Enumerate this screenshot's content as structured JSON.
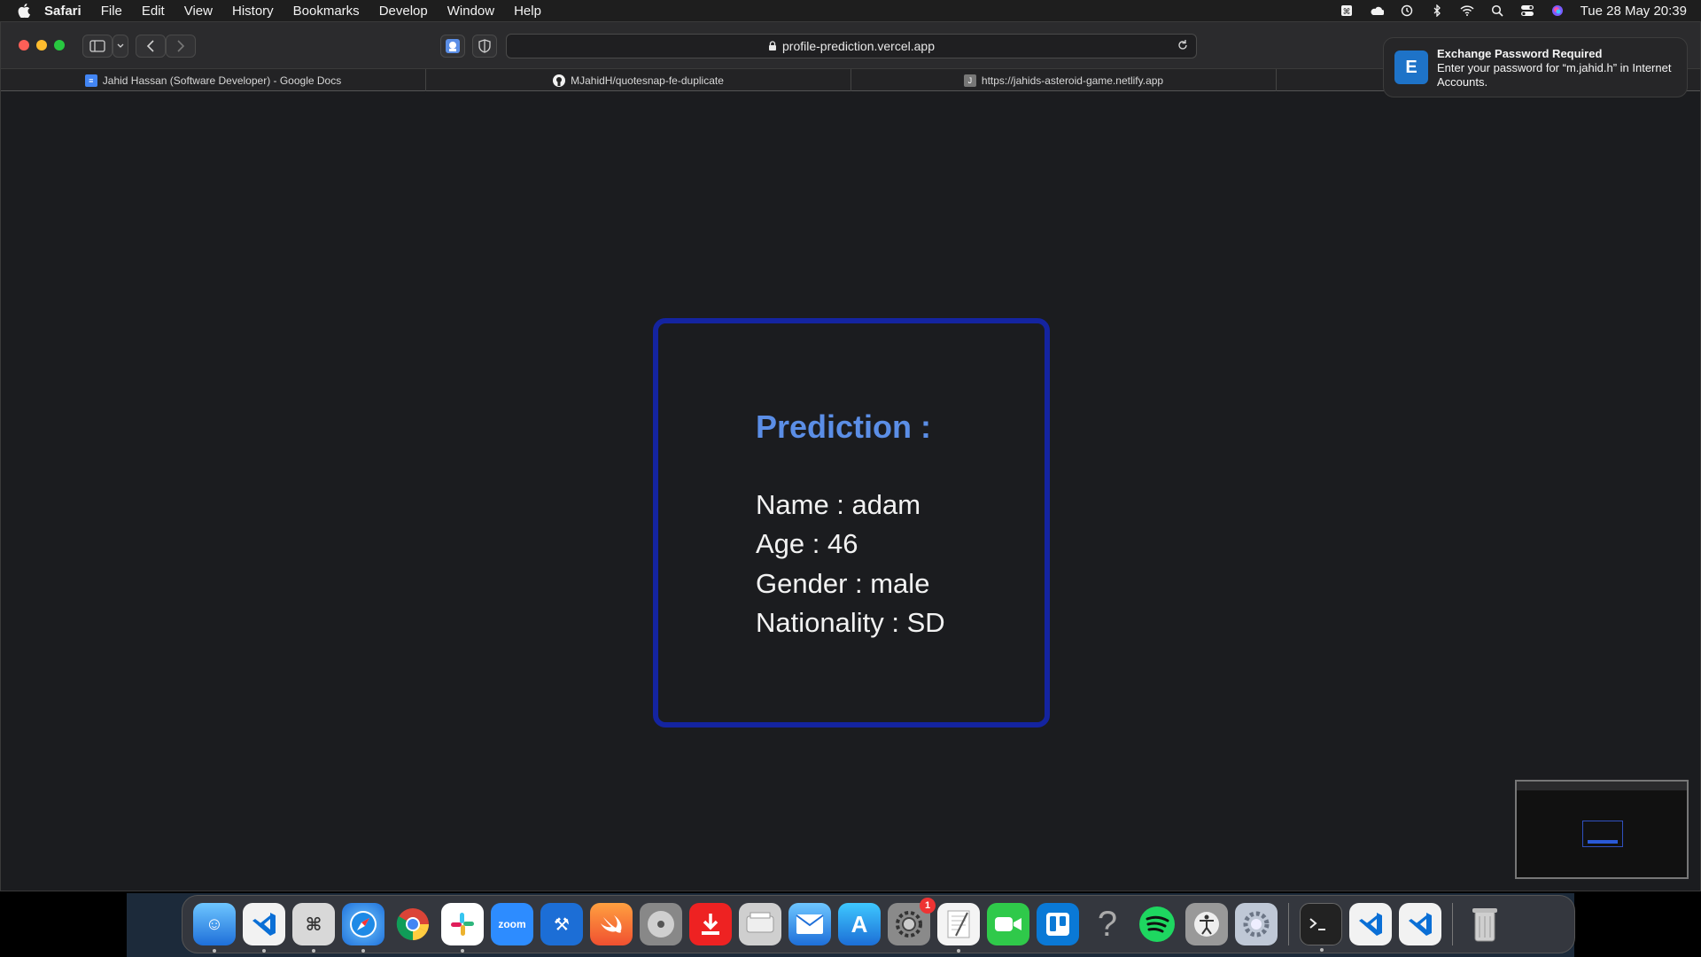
{
  "menubar": {
    "app": "Safari",
    "items": [
      "File",
      "Edit",
      "View",
      "History",
      "Bookmarks",
      "Develop",
      "Window",
      "Help"
    ],
    "datetime": "Tue 28 May  20:39"
  },
  "toolbar": {
    "url": "profile-prediction.vercel.app"
  },
  "tabs": [
    {
      "label": "Jahid Hassan (Software Developer) - Google Docs"
    },
    {
      "label": "MJahidH/quotesnap-fe-duplicate"
    },
    {
      "label": "https://jahids-asteroid-game.netlify.app"
    }
  ],
  "notification": {
    "title": "Exchange Password Required",
    "body": "Enter your password for “m.jahid.h” in Internet Accounts."
  },
  "prediction": {
    "title": "Prediction :",
    "name": "Name : adam",
    "age": "Age : 46",
    "gender": "Gender : male",
    "nationality": "Nationality : SD"
  },
  "dock": {
    "badge_count": "1"
  }
}
